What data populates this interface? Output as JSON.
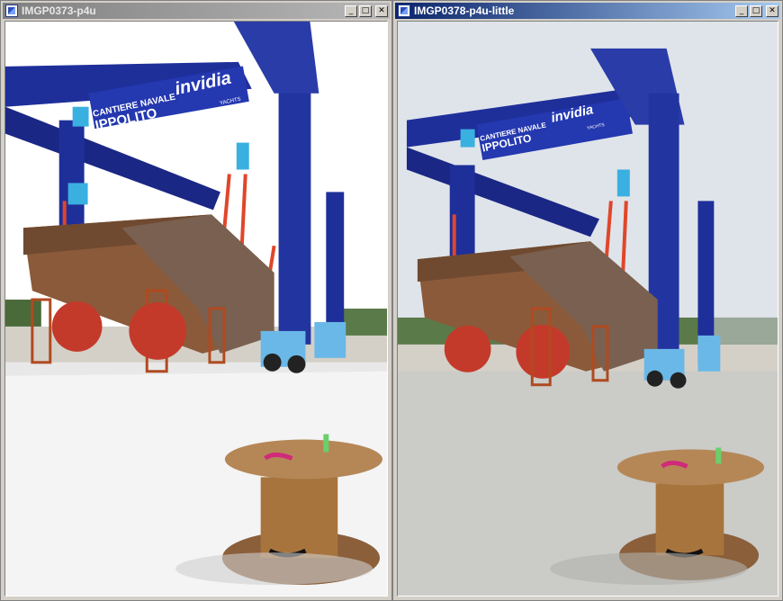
{
  "windows": [
    {
      "title": "IMGP0373-p4u",
      "active": false,
      "controls": {
        "minimize": "_",
        "maximize": "□",
        "close": "✕"
      },
      "sign": {
        "line1": "CANTIERE NAVALE",
        "line2": "IPPOLITO",
        "brand": "invidia",
        "brand_sub": "YACHTS"
      }
    },
    {
      "title": "IMGP0378-p4u-little",
      "active": true,
      "controls": {
        "minimize": "_",
        "maximize": "□",
        "close": "✕"
      },
      "sign": {
        "line1": "CANTIERE NAVALE",
        "line2": "IPPOLITO",
        "brand": "invidia",
        "brand_sub": "YACHTS"
      }
    }
  ],
  "colors": {
    "active_title": "#0a246a",
    "inactive_title": "#808080",
    "crane_blue": "#1f2f9a",
    "hull_rust": "#8b5a3a",
    "sky_left": "#ffffff",
    "sky_right": "#dfe4ea"
  }
}
